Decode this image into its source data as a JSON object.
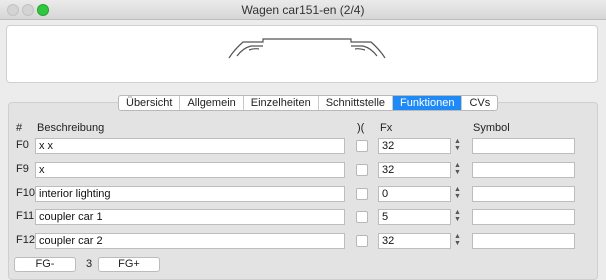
{
  "window": {
    "title": "Wagen car151-en (2/4)"
  },
  "tabs": [
    "Übersicht",
    "Allgemein",
    "Einzelheiten",
    "Schnittstelle",
    "Funktionen",
    "CVs"
  ],
  "active_tab": "Funktionen",
  "columns": {
    "num": "#",
    "description": "Beschreibung",
    "toggle": ")(",
    "fx": "Fx",
    "symbol": "Symbol"
  },
  "rows": [
    {
      "label": "F0",
      "description": "x x",
      "fx": "32",
      "symbol": ""
    },
    {
      "label": "F9",
      "description": "x",
      "fx": "32",
      "symbol": ""
    },
    {
      "label": "F10",
      "description": "interior lighting",
      "fx": "0",
      "symbol": ""
    },
    {
      "label": "F11",
      "description": "coupler car 1",
      "fx": "5",
      "symbol": ""
    },
    {
      "label": "F12",
      "description": "coupler car 2",
      "fx": "32",
      "symbol": ""
    }
  ],
  "footer": {
    "prev_label": "FG-",
    "group": "3",
    "next_label": "FG+"
  },
  "stepper_glyphs": {
    "up": "▲",
    "down": "▼"
  },
  "colors": {
    "accent": "#1d8af7",
    "maximize": "#2fc740"
  }
}
